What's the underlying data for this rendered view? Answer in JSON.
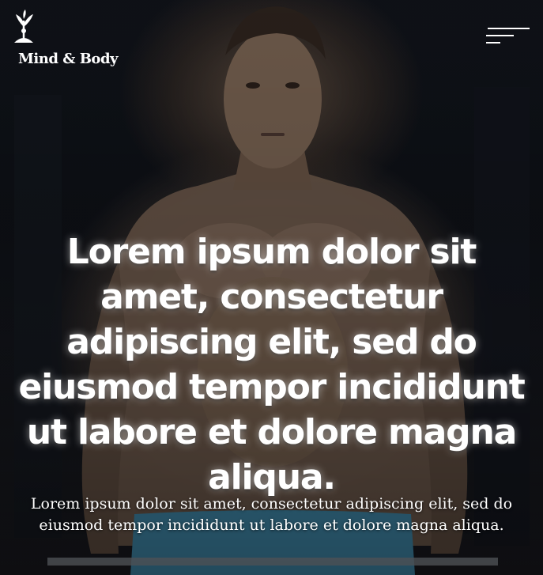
{
  "brand": {
    "name": "Mind & Body",
    "logo_icon": "tree-person-icon"
  },
  "nav": {
    "menu_icon": "hamburger-menu-icon"
  },
  "hero": {
    "headline": "Lorem ipsum dolor sit amet, consectetur adipiscing elit, sed do eiusmod tempor incididunt ut labore et dolore magna aliqua.",
    "subtext": "Lorem ipsum dolor sit amet, consectetur adipiscing elit, sed do eiusmod tempor incididunt ut labore et dolore magna aliqua.",
    "background_image": "muscular-man-gym-photo"
  },
  "colors": {
    "text": "#ffffff",
    "background": "#0b0e14"
  }
}
